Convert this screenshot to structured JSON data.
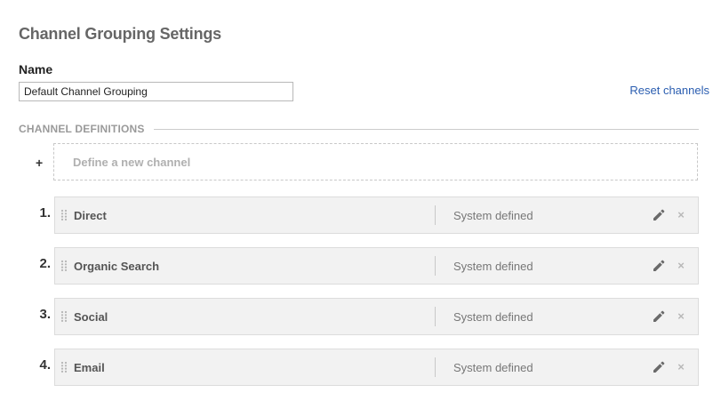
{
  "header": {
    "title": "Channel Grouping Settings"
  },
  "name_field": {
    "label": "Name",
    "value": "Default Channel Grouping"
  },
  "reset_link": "Reset channels",
  "section": {
    "title": "CHANNEL DEFINITIONS"
  },
  "define_new": {
    "plus": "+",
    "label": "Define a new channel"
  },
  "channels": [
    {
      "number": "1.",
      "name": "Direct",
      "type": "System defined"
    },
    {
      "number": "2.",
      "name": "Organic Search",
      "type": "System defined"
    },
    {
      "number": "3.",
      "name": "Social",
      "type": "System defined"
    },
    {
      "number": "4.",
      "name": "Email",
      "type": "System defined"
    }
  ],
  "icons": {
    "drag": "drag-handle-icon",
    "edit": "pencil-icon",
    "delete": "close-icon",
    "delete_glyph": "×"
  },
  "colors": {
    "link": "#2a5db0",
    "card_bg": "#f2f2f2",
    "heading": "#666666"
  }
}
